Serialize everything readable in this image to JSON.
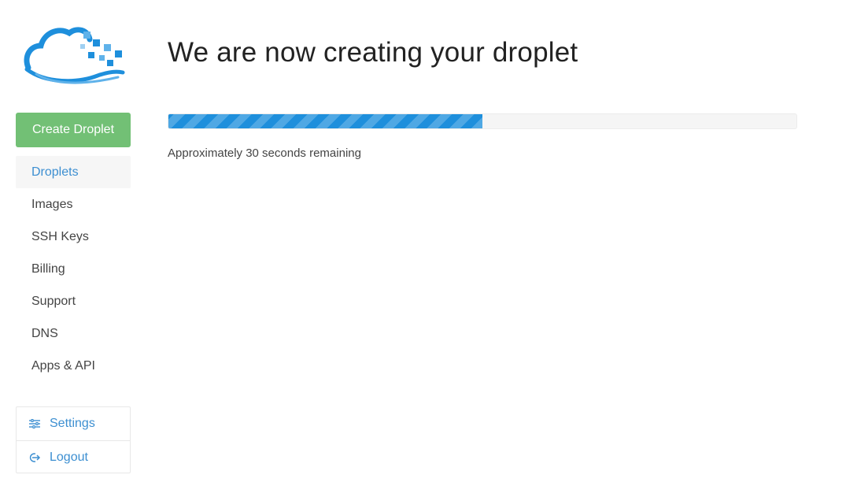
{
  "brand": {
    "logo_icon": "cloud-logo-icon",
    "accent": "#1e8fdc"
  },
  "sidebar": {
    "create_button": {
      "label": "Create Droplet",
      "color": "#72c075"
    },
    "items": [
      {
        "label": "Droplets",
        "active": true
      },
      {
        "label": "Images",
        "active": false
      },
      {
        "label": "SSH Keys",
        "active": false
      },
      {
        "label": "Billing",
        "active": false
      },
      {
        "label": "Support",
        "active": false
      },
      {
        "label": "DNS",
        "active": false
      },
      {
        "label": "Apps & API",
        "active": false
      }
    ],
    "account": [
      {
        "label": "Settings",
        "icon": "sliders-icon"
      },
      {
        "label": "Logout",
        "icon": "logout-icon"
      }
    ]
  },
  "main": {
    "title": "We are now creating your droplet",
    "progress": {
      "fraction": 0.5,
      "color": "#1e8fdc"
    },
    "status": "Approximately 30 seconds remaining"
  }
}
